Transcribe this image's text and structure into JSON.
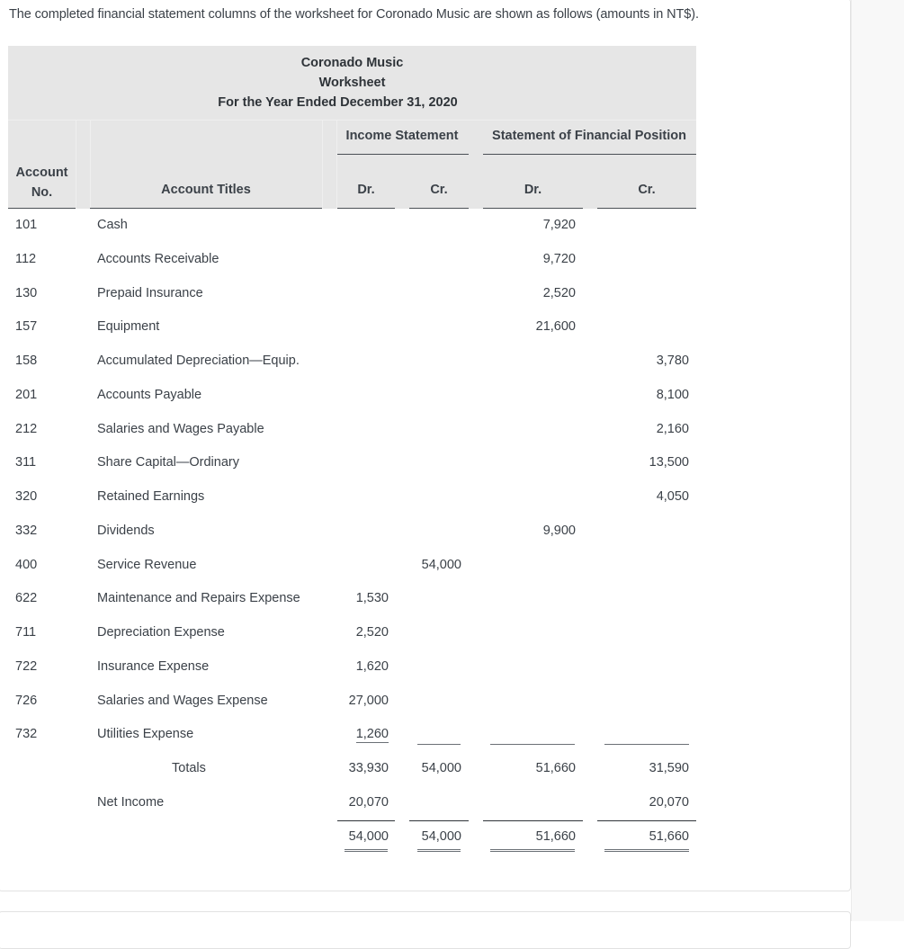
{
  "intro_text": "The completed financial statement columns of the worksheet for Coronado Music are shown as follows (amounts in NT$).",
  "header": {
    "company": "Coronado Music",
    "document": "Worksheet",
    "period": "For the Year Ended December 31, 2020",
    "group_income_statement": "Income Statement",
    "group_financial_position": "Statement of Financial Position",
    "col_account_no": "Account No.",
    "col_account_no_line1": "Account",
    "col_account_no_line2": "No.",
    "col_account_titles": "Account Titles",
    "col_is_dr": "Dr.",
    "col_is_cr": "Cr.",
    "col_sfp_dr": "Dr.",
    "col_sfp_cr": "Cr."
  },
  "rows": [
    {
      "no": "101",
      "title": "Cash",
      "is_dr": "",
      "is_cr": "",
      "sfp_dr": "7,920",
      "sfp_cr": ""
    },
    {
      "no": "112",
      "title": "Accounts Receivable",
      "is_dr": "",
      "is_cr": "",
      "sfp_dr": "9,720",
      "sfp_cr": ""
    },
    {
      "no": "130",
      "title": "Prepaid Insurance",
      "is_dr": "",
      "is_cr": "",
      "sfp_dr": "2,520",
      "sfp_cr": ""
    },
    {
      "no": "157",
      "title": "Equipment",
      "is_dr": "",
      "is_cr": "",
      "sfp_dr": "21,600",
      "sfp_cr": ""
    },
    {
      "no": "158",
      "title": "Accumulated Depreciation—Equip.",
      "is_dr": "",
      "is_cr": "",
      "sfp_dr": "",
      "sfp_cr": "3,780"
    },
    {
      "no": "201",
      "title": "Accounts Payable",
      "is_dr": "",
      "is_cr": "",
      "sfp_dr": "",
      "sfp_cr": "8,100"
    },
    {
      "no": "212",
      "title": "Salaries and Wages Payable",
      "is_dr": "",
      "is_cr": "",
      "sfp_dr": "",
      "sfp_cr": "2,160"
    },
    {
      "no": "311",
      "title": "Share Capital—Ordinary",
      "is_dr": "",
      "is_cr": "",
      "sfp_dr": "",
      "sfp_cr": "13,500"
    },
    {
      "no": "320",
      "title": "Retained Earnings",
      "is_dr": "",
      "is_cr": "",
      "sfp_dr": "",
      "sfp_cr": "4,050"
    },
    {
      "no": "332",
      "title": "Dividends",
      "is_dr": "",
      "is_cr": "",
      "sfp_dr": "9,900",
      "sfp_cr": ""
    },
    {
      "no": "400",
      "title": "Service Revenue",
      "is_dr": "",
      "is_cr": "54,000",
      "sfp_dr": "",
      "sfp_cr": ""
    },
    {
      "no": "622",
      "title": "Maintenance and Repairs Expense",
      "is_dr": "1,530",
      "is_cr": "",
      "sfp_dr": "",
      "sfp_cr": ""
    },
    {
      "no": "711",
      "title": "Depreciation Expense",
      "is_dr": "2,520",
      "is_cr": "",
      "sfp_dr": "",
      "sfp_cr": ""
    },
    {
      "no": "722",
      "title": "Insurance Expense",
      "is_dr": "1,620",
      "is_cr": "",
      "sfp_dr": "",
      "sfp_cr": ""
    },
    {
      "no": "726",
      "title": "Salaries and Wages Expense",
      "is_dr": "27,000",
      "is_cr": "",
      "sfp_dr": "",
      "sfp_cr": ""
    },
    {
      "no": "732",
      "title": "Utilities Expense",
      "is_dr": "1,260",
      "is_cr": "",
      "sfp_dr": "",
      "sfp_cr": ""
    }
  ],
  "totals": {
    "label": "Totals",
    "is_dr": "33,930",
    "is_cr": "54,000",
    "sfp_dr": "51,660",
    "sfp_cr": "31,590"
  },
  "net_income": {
    "label": "Net Income",
    "is_dr": "20,070",
    "is_cr": "",
    "sfp_dr": "",
    "sfp_cr": "20,070"
  },
  "final_totals": {
    "is_dr": "54,000",
    "is_cr": "54,000",
    "sfp_dr": "51,660",
    "sfp_cr": "51,660"
  }
}
